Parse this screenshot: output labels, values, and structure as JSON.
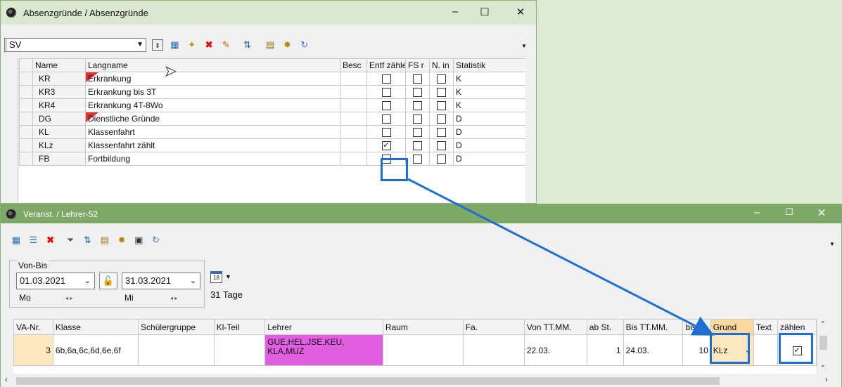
{
  "top_window": {
    "title": "Absenzgründe / Absenzgründe",
    "filter_value": "SV",
    "columns": [
      "Name",
      "Langname",
      "Besc",
      "Entf zähle",
      "FS r",
      "N. in",
      "Statistik"
    ],
    "rows": [
      {
        "name": "KR",
        "langname": "Erkrankung",
        "flag": true,
        "entf": "",
        "fs": "",
        "nin": "",
        "stat": "K"
      },
      {
        "name": "KR3",
        "langname": "Erkrankung bis 3T",
        "flag": false,
        "entf": "",
        "fs": "",
        "nin": "",
        "stat": "K"
      },
      {
        "name": "KR4",
        "langname": "Erkrankung 4T-8Wo",
        "flag": false,
        "entf": "",
        "fs": "",
        "nin": "",
        "stat": "K"
      },
      {
        "name": "DG",
        "langname": "Dienstliche Gründe",
        "flag": true,
        "entf": "",
        "fs": "",
        "nin": "",
        "stat": "D"
      },
      {
        "name": "KL",
        "langname": "Klassenfahrt",
        "flag": false,
        "entf": "",
        "fs": "",
        "nin": "",
        "stat": "D"
      },
      {
        "name": "KLz",
        "langname": "Klassenfahrt zählt",
        "flag": false,
        "entf": "✓",
        "fs": "",
        "nin": "",
        "stat": "D"
      },
      {
        "name": "FB",
        "langname": "Fortbildung",
        "flag": false,
        "entf": "",
        "fs": "",
        "nin": "",
        "stat": "D"
      }
    ]
  },
  "bottom_window": {
    "title": "Veranst. / Lehrer-52",
    "group_label": "Von-Bis",
    "from_date": "01.03.2021",
    "to_date": "31.03.2021",
    "from_day": "Mo",
    "to_day": "Mi",
    "calendar_badge": "18",
    "days_label": "31 Tage",
    "columns": [
      "VA-Nr.",
      "Klasse",
      "Schülergruppe",
      "Kl-Teil",
      "Lehrer",
      "Raum",
      "Fa.",
      "Von TT.MM.",
      "ab St.",
      "Bis TT.MM.",
      "bis St.",
      "Grund",
      "Text",
      "zählen"
    ],
    "row": {
      "va_nr": "3",
      "klasse": "6b,6a,6c,6d,6e,6f",
      "lehrer": "GUE,HEL,JSE,KEU, KLA,MUZ",
      "von": "22.03.",
      "ab_st": "1",
      "bis": "24.03.",
      "bis_st": "10",
      "grund": "KLz",
      "zaehlen": "✓"
    }
  },
  "window_controls": {
    "minimize": "–",
    "maximize": "☐",
    "close": "✕"
  },
  "colors": {
    "highlight": "#1f6fd1",
    "lehrer_bg": "#e060e0",
    "titlebar_bottom": "#7da867"
  }
}
